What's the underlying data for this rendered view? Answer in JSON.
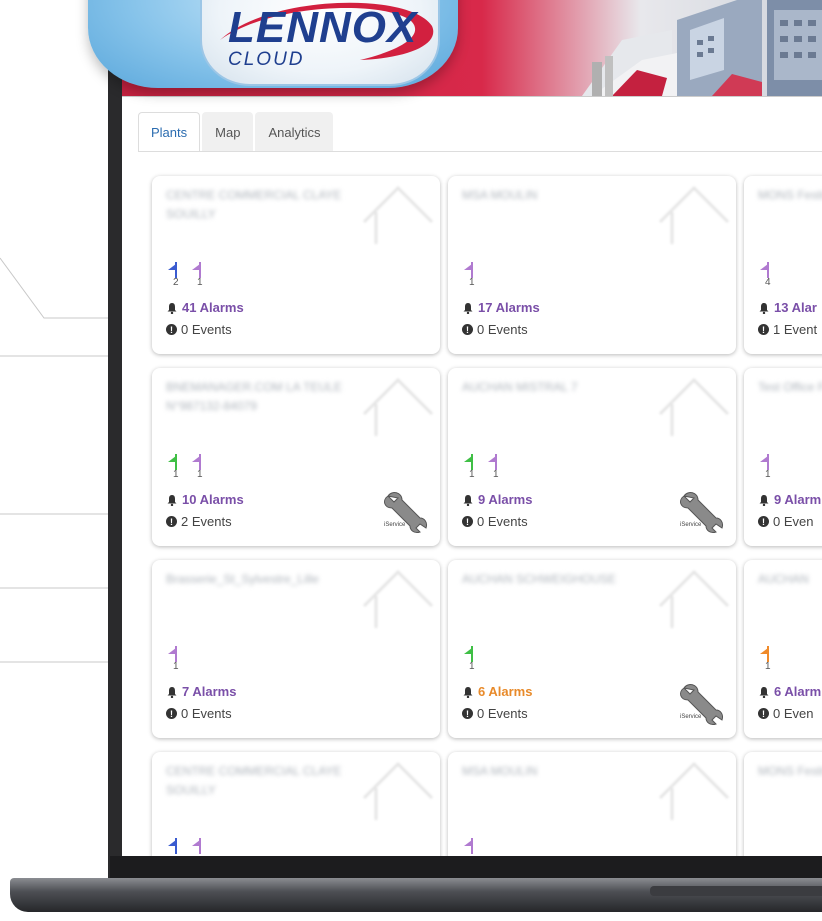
{
  "logo": {
    "title": "LENNOX",
    "subtitle": "CLOUD"
  },
  "tabs": [
    {
      "label": "Plants",
      "active": true
    },
    {
      "label": "Map",
      "active": false
    },
    {
      "label": "Analytics",
      "active": false
    }
  ],
  "cards": [
    {
      "name": "CENTRE COMMERCIAL CLAYE SOUILLY",
      "flags": [
        {
          "count": "2",
          "color": "#3a5bd0"
        },
        {
          "count": "1",
          "color": "#b07ad0"
        }
      ],
      "alarms": "41 Alarms",
      "events": "0 Events",
      "service": false
    },
    {
      "name": "MSA MOULIN",
      "flags": [
        {
          "count": "1",
          "color": "#b07ad0"
        }
      ],
      "alarms": "17 Alarms",
      "events": "0 Events",
      "service": false
    },
    {
      "name": "MONS Festival",
      "flags": [
        {
          "count": "4",
          "color": "#b07ad0"
        }
      ],
      "alarms": "13 Alar",
      "events": "1 Event",
      "service": false
    },
    {
      "name": "BNEMANAGER.COM LA TEULE N°987132-84079",
      "flags": [
        {
          "count": "1",
          "color": "#3fbf45"
        },
        {
          "count": "1",
          "color": "#b07ad0"
        }
      ],
      "alarms": "10 Alarms",
      "events": "2 Events",
      "service": true
    },
    {
      "name": "AUCHAN MISTRAL 7",
      "flags": [
        {
          "count": "1",
          "color": "#3fbf45"
        },
        {
          "count": "1",
          "color": "#b07ad0"
        }
      ],
      "alarms": "9 Alarms",
      "events": "0 Events",
      "service": true
    },
    {
      "name": "Test Office Fromont",
      "flags": [
        {
          "count": "1",
          "color": "#b07ad0"
        }
      ],
      "alarms": "9 Alarm",
      "events": "0 Even",
      "service": false
    },
    {
      "name": "Brasserie_St_Sylvestre_Lille",
      "flags": [
        {
          "count": "1",
          "color": "#b07ad0"
        }
      ],
      "alarms": "7 Alarms",
      "events": "0 Events",
      "service": false
    },
    {
      "name": "AUCHAN SCHWEIGHOUSE",
      "flags": [
        {
          "count": "1",
          "color": "#3fbf45"
        }
      ],
      "alarms": "6 Alarms",
      "events": "0 Events",
      "service": true,
      "warn": true
    },
    {
      "name": "AUCHAN",
      "flags": [
        {
          "count": "1",
          "color": "#f08a2a"
        }
      ],
      "alarms": "6 Alarm",
      "events": "0 Even",
      "service": false
    },
    {
      "name": "CENTRE COMMERCIAL CLAYE SOUILLY",
      "flags": [
        {
          "count": "",
          "color": "#3a5bd0"
        },
        {
          "count": "",
          "color": "#b07ad0"
        }
      ],
      "alarms": "",
      "events": "",
      "service": false
    },
    {
      "name": "MSA MOULIN",
      "flags": [
        {
          "count": "",
          "color": "#b07ad0"
        }
      ],
      "alarms": "",
      "events": "",
      "service": false
    },
    {
      "name": "MONS Festival",
      "flags": [],
      "alarms": "",
      "events": "",
      "service": false
    }
  ],
  "service_label": "iService",
  "colors": {
    "header_red": "#d8294a",
    "alarm_purple": "#7a4fa8",
    "alarm_orange": "#e88a2a",
    "tab_active": "#2b6cb0"
  }
}
